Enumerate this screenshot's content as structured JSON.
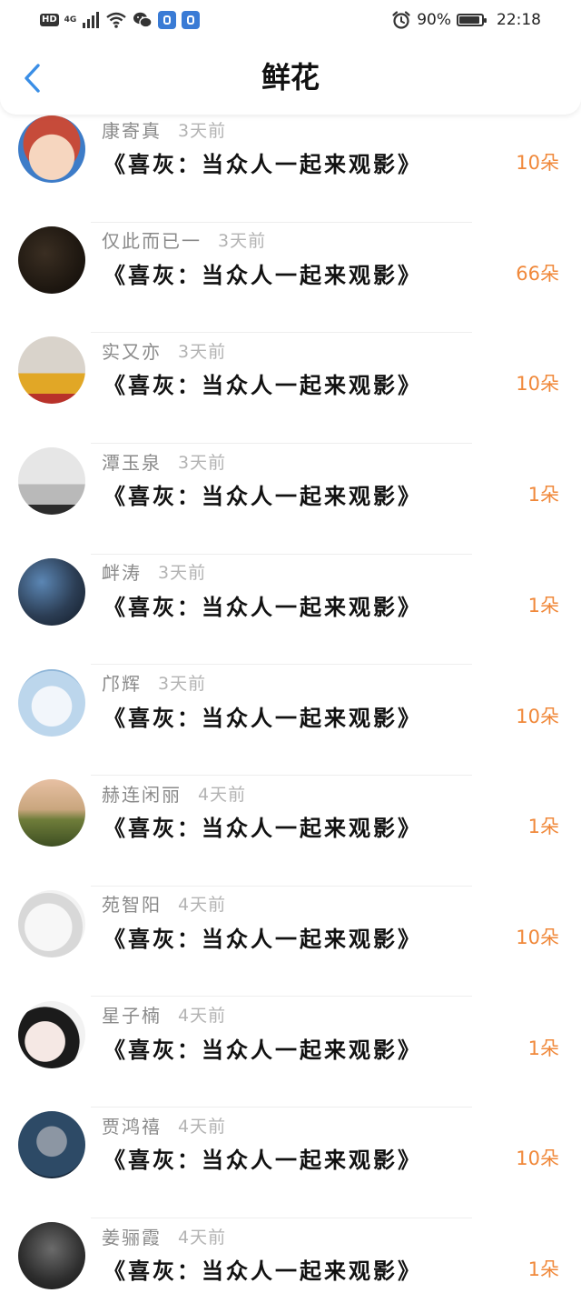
{
  "status_bar": {
    "hd": "HD",
    "network": "4G",
    "battery_percent": "90%",
    "battery_level": 0.9,
    "time": "22:18",
    "icons": [
      "signal-icon",
      "wifi-icon",
      "wechat-icon",
      "app-notification-icon",
      "alarm-icon",
      "battery-icon"
    ]
  },
  "header": {
    "title": "鲜花",
    "back_icon": "back-chevron-icon",
    "accent_color": "#3a8ee6"
  },
  "colors": {
    "count": "#f0883a",
    "name": "#8a8a8a",
    "time": "#b3b3b3"
  },
  "rows": [
    {
      "name": "康寄真",
      "time": "3天前",
      "title": "《喜灰：当众人一起来观影》",
      "count": "10朵",
      "avatar": "cartoon-bull-avatar"
    },
    {
      "name": "仅此而已一",
      "time": "3天前",
      "title": "《喜灰：当众人一起来观影》",
      "count": "66朵",
      "avatar": "dark-photo-avatar"
    },
    {
      "name": "实又亦",
      "time": "3天前",
      "title": "《喜灰：当众人一起来观影》",
      "count": "10朵",
      "avatar": "man-sunglasses-avatar"
    },
    {
      "name": "潭玉泉",
      "time": "3天前",
      "title": "《喜灰：当众人一起来观影》",
      "count": "1朵",
      "avatar": "seaside-person-avatar"
    },
    {
      "name": "衅涛",
      "time": "3天前",
      "title": "《喜灰：当众人一起来观影》",
      "count": "1朵",
      "avatar": "hands-photo-avatar"
    },
    {
      "name": "邝辉",
      "time": "3天前",
      "title": "《喜灰：当众人一起来观影》",
      "count": "10朵",
      "avatar": "anime-girl-avatar"
    },
    {
      "name": "赫连闲丽",
      "time": "4天前",
      "title": "《喜灰：当众人一起来观影》",
      "count": "1朵",
      "avatar": "sunset-field-avatar"
    },
    {
      "name": "苑智阳",
      "time": "4天前",
      "title": "《喜灰：当众人一起来观影》",
      "count": "10朵",
      "avatar": "sketch-boy-avatar"
    },
    {
      "name": "星子楠",
      "time": "4天前",
      "title": "《喜灰：当众人一起来观影》",
      "count": "1朵",
      "avatar": "anime-couple-avatar"
    },
    {
      "name": "贾鸿禧",
      "time": "4天前",
      "title": "《喜灰：当众人一起来观影》",
      "count": "10朵",
      "avatar": "glasses-man-avatar"
    },
    {
      "name": "姜骊霞",
      "time": "4天前",
      "title": "《喜灰：当众人一起来观影》",
      "count": "1朵",
      "avatar": "dark-street-avatar"
    }
  ]
}
